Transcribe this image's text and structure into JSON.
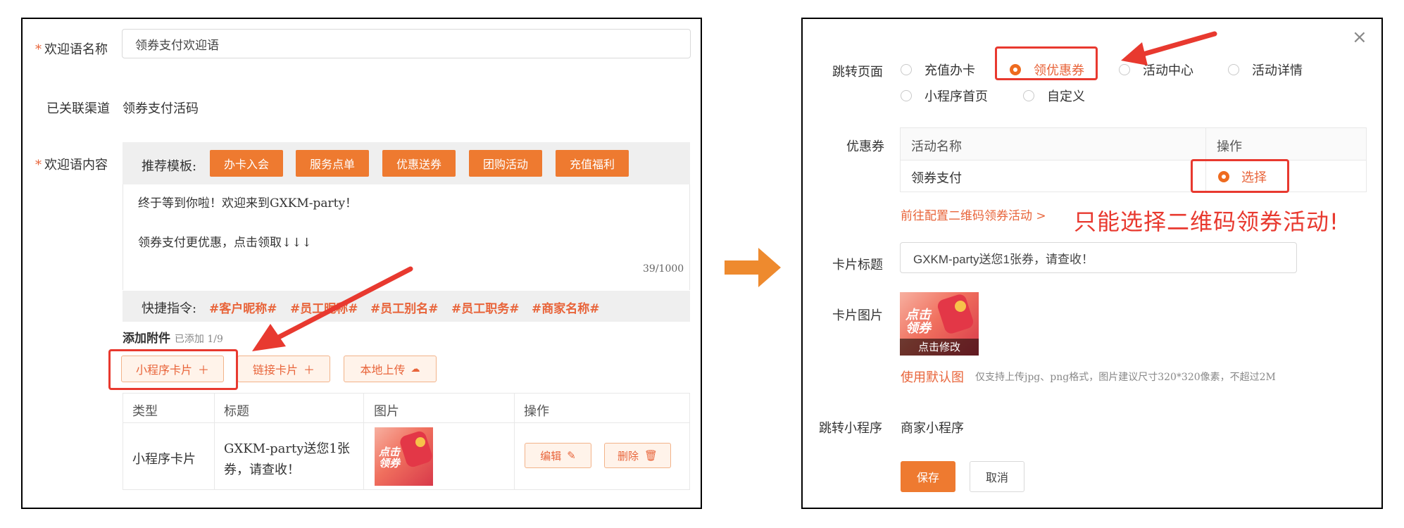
{
  "left": {
    "welcome_name_label": "欢迎语名称",
    "welcome_name_value": "领券支付欢迎语",
    "channel_label": "已关联渠道",
    "channel_value": "领券支付活码",
    "content_label": "欢迎语内容",
    "template_label": "推荐模板:",
    "templates": [
      "办卡入会",
      "服务点单",
      "优惠送券",
      "团购活动",
      "充值福利"
    ],
    "message_line1": "终于等到你啦！欢迎来到GXKM-party！",
    "message_line2": "领券支付更优惠，点击领取↓↓↓",
    "char_count": "39/1000",
    "shortcut_label": "快捷指令:",
    "shortcuts": [
      "#客户昵称#",
      "#员工昵称#",
      "#员工别名#",
      "#员工职务#",
      "#商家名称#"
    ],
    "attach_label": "添加附件",
    "attach_count": "已添加 1/9",
    "attach_buttons": [
      "小程序卡片",
      "链接卡片",
      "本地上传"
    ],
    "table_headers": [
      "类型",
      "标题",
      "图片",
      "操作"
    ],
    "row": {
      "type": "小程序卡片",
      "title_line1": "GXKM-party送您1张",
      "title_line2": "券，请查收！",
      "image_text_1": "点击",
      "image_text_2": "领券",
      "edit": "编辑",
      "delete": "删除"
    }
  },
  "right": {
    "jump_label": "跳转页面",
    "jump_options": [
      "充值办卡",
      "领优惠券",
      "活动中心",
      "活动详情",
      "小程序首页",
      "自定义"
    ],
    "selected_option": "领优惠券",
    "coupon_label": "优惠券",
    "coupon_headers": [
      "活动名称",
      "操作"
    ],
    "coupon_row_name": "领券支付",
    "coupon_row_action": "选择",
    "config_link": "前往配置二维码领券活动 >",
    "annotation": "只能选择二维码领券活动!",
    "card_title_label": "卡片标题",
    "card_title_value": "GXKM-party送您1张券，请查收！",
    "card_image_label": "卡片图片",
    "card_image_text_1": "点击",
    "card_image_text_2": "领券",
    "card_image_overlay": "点击修改",
    "default_image_link": "使用默认图",
    "image_hint": "仅支持上传jpg、png格式，图片建议尺寸320*320像素，不超过2M",
    "mini_program_label": "跳转小程序",
    "mini_program_value": "商家小程序",
    "save": "保存",
    "cancel": "取消",
    "close_icon": "×"
  },
  "colors": {
    "accent": "#ee7a30",
    "annotation_red": "#e8392f",
    "arrow_orange": "#ee8a2e"
  }
}
